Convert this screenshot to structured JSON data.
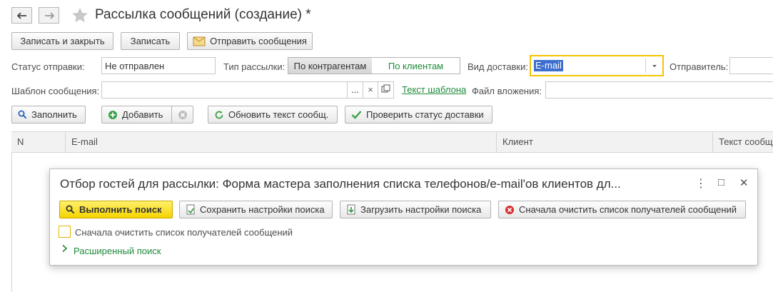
{
  "window": {
    "title": "Рассылка сообщений (создание) *"
  },
  "toolbar": {
    "save_close": "Записать и закрыть",
    "save": "Записать",
    "send": "Отправить сообщения"
  },
  "form": {
    "status_label": "Статус отправки:",
    "status_value": "Не отправлен",
    "type_label": "Тип рассылки:",
    "type_options": [
      "По контрагентам",
      "По клиентам"
    ],
    "delivery_label": "Вид доставки:",
    "delivery_value": "E-mail",
    "sender_label": "Отправитель:",
    "template_label": "Шаблон сообщения:",
    "template_value": "",
    "template_dots": "...",
    "template_clear": "×",
    "template_link": "Текст шаблона",
    "attach_label": "Файл вложения:"
  },
  "actions": {
    "fill": "Заполнить",
    "add": "Добавить",
    "refresh_text": "Обновить текст сообщ.",
    "check_status": "Проверить статус доставки"
  },
  "table": {
    "columns": [
      "N",
      "E-mail",
      "Клиент",
      "Текст сообщ"
    ]
  },
  "dialog": {
    "title": "Отбор гостей для рассылки: Форма мастера заполнения списка телефонов/e-mail'ов клиентов дл...",
    "search_btn": "Выполнить поиск",
    "save_settings": "Сохранить настройки поиска",
    "load_settings": "Загрузить настройки поиска",
    "clear_recipients": "Сначала очистить список получателей сообщений",
    "checkbox_label": "Сначала очистить список получателей сообщений",
    "advanced_search": "Расширенный поиск",
    "more_icon": "⋮",
    "maximize_icon": "□",
    "close_icon": "✕"
  },
  "colors": {
    "accent_green": "#1e8a3a",
    "focus_yellow": "#f5c400",
    "selection_blue": "#3c6fd0"
  }
}
